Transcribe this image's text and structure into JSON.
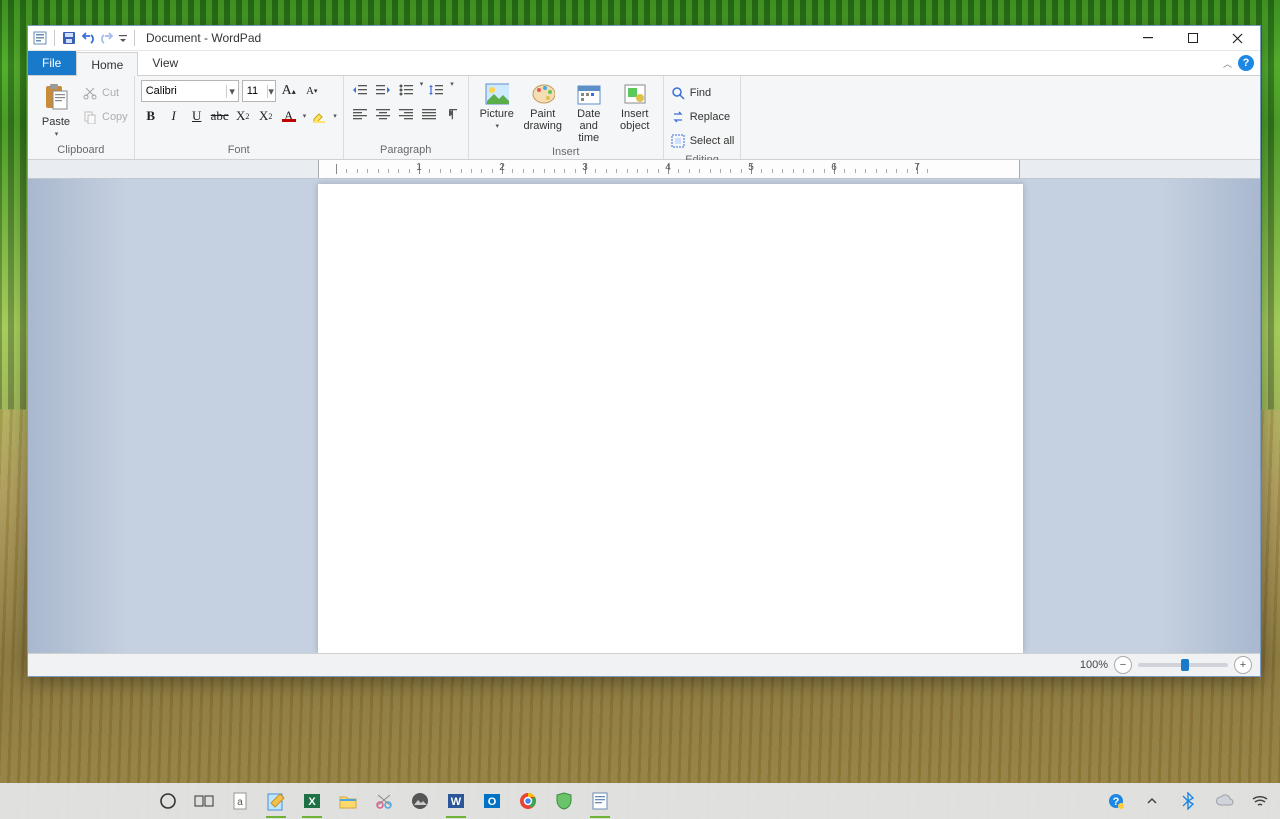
{
  "title": "Document - WordPad",
  "tabs": {
    "file": "File",
    "home": "Home",
    "view": "View"
  },
  "groups": {
    "clipboard": "Clipboard",
    "font": "Font",
    "paragraph": "Paragraph",
    "insert": "Insert",
    "editing": "Editing"
  },
  "clipboard": {
    "paste": "Paste",
    "cut": "Cut",
    "copy": "Copy"
  },
  "font": {
    "name": "Calibri",
    "size": "11"
  },
  "insert": {
    "picture": "Picture",
    "paint1": "Paint",
    "paint2": "drawing",
    "date1": "Date and",
    "date2": "time",
    "obj1": "Insert",
    "obj2": "object"
  },
  "editing": {
    "find": "Find",
    "replace": "Replace",
    "selectall": "Select all"
  },
  "ruler": {
    "numbers": [
      "1",
      "2",
      "3",
      "4",
      "5",
      "6",
      "7"
    ]
  },
  "status": {
    "zoom": "100%"
  }
}
